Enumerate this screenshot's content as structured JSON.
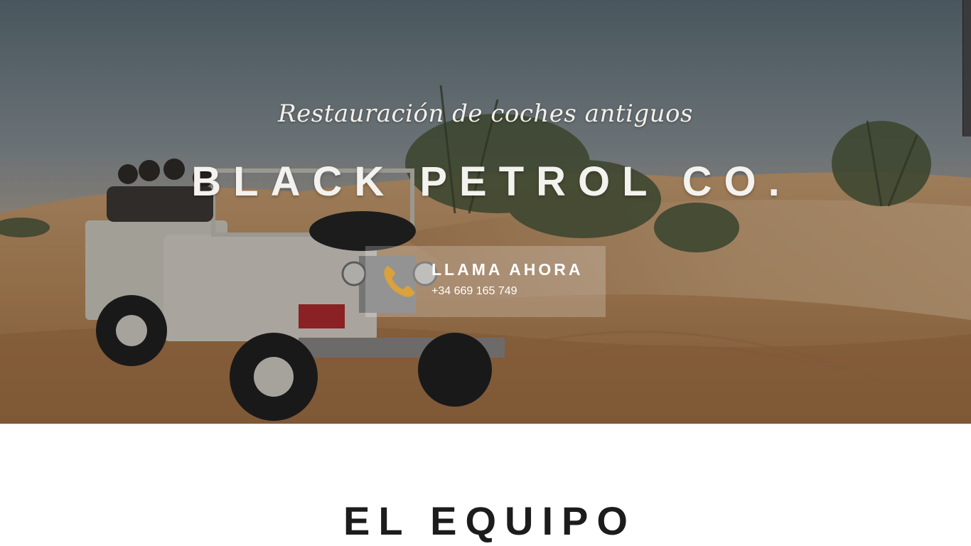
{
  "hero": {
    "tagline": "Restauración de coches antiguos",
    "brand_title": "BLACK PETROL CO.",
    "background_image": "vintage-land-rover-desert-photo",
    "cta": {
      "icon": "phone-icon",
      "title": "LLAMA AHORA",
      "phone": "+34 669 165 749",
      "icon_color": "#d9a23c"
    }
  },
  "team_section": {
    "title": "EL EQUIPO"
  },
  "colors": {
    "hero_text": "#f4f2ee",
    "accent": "#d9a23c",
    "heading_dark": "#1c1c1c",
    "sand": "#c8935a"
  }
}
